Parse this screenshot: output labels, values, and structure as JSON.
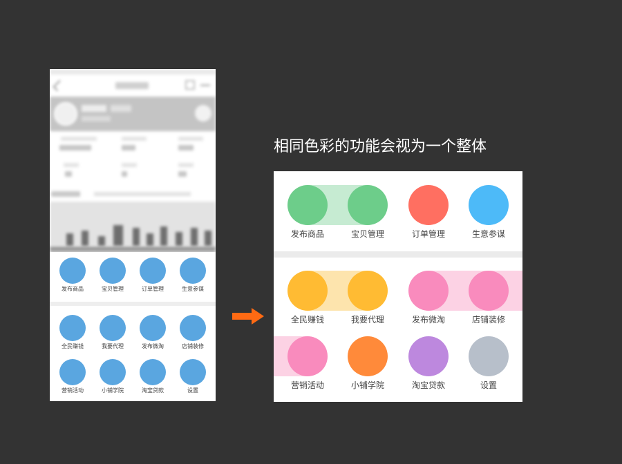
{
  "headline": "相同色彩的功能会视为一个整体",
  "phone": {
    "menu_top": [
      {
        "label": "发布商品"
      },
      {
        "label": "宝贝管理"
      },
      {
        "label": "订单管理"
      },
      {
        "label": "生意参谋"
      }
    ],
    "menu_bottom": [
      {
        "label": "全民赚钱"
      },
      {
        "label": "我要代理"
      },
      {
        "label": "发布微淘"
      },
      {
        "label": "店铺装修"
      },
      {
        "label": "营销活动"
      },
      {
        "label": "小铺学院"
      },
      {
        "label": "淘宝贷款"
      },
      {
        "label": "设置"
      }
    ],
    "icon_color": "#5aa6e0"
  },
  "panel": {
    "row1": [
      {
        "label": "发布商品",
        "color": "#6dcd8a"
      },
      {
        "label": "宝贝管理",
        "color": "#6dcd8a"
      },
      {
        "label": "订单管理",
        "color": "#ff6f61"
      },
      {
        "label": "生意参谋",
        "color": "#4dbaf8"
      }
    ],
    "row2": [
      {
        "label": "全民赚钱",
        "color": "#ffbb33"
      },
      {
        "label": "我要代理",
        "color": "#ffbb33"
      },
      {
        "label": "发布微淘",
        "color": "#f98bbd"
      },
      {
        "label": "店铺装修",
        "color": "#f98bbd"
      }
    ],
    "row3": [
      {
        "label": "营销活动",
        "color": "#f98bbd"
      },
      {
        "label": "小铺学院",
        "color": "#ff8a3a"
      },
      {
        "label": "淘宝贷款",
        "color": "#bd88de"
      },
      {
        "label": "设置",
        "color": "#b7bfca"
      }
    ],
    "group_colors": {
      "green": "#c6ebd2",
      "yellow": "#fde4ad",
      "pink": "#fcd2e4"
    }
  },
  "arrow_color": "#ff6a13"
}
